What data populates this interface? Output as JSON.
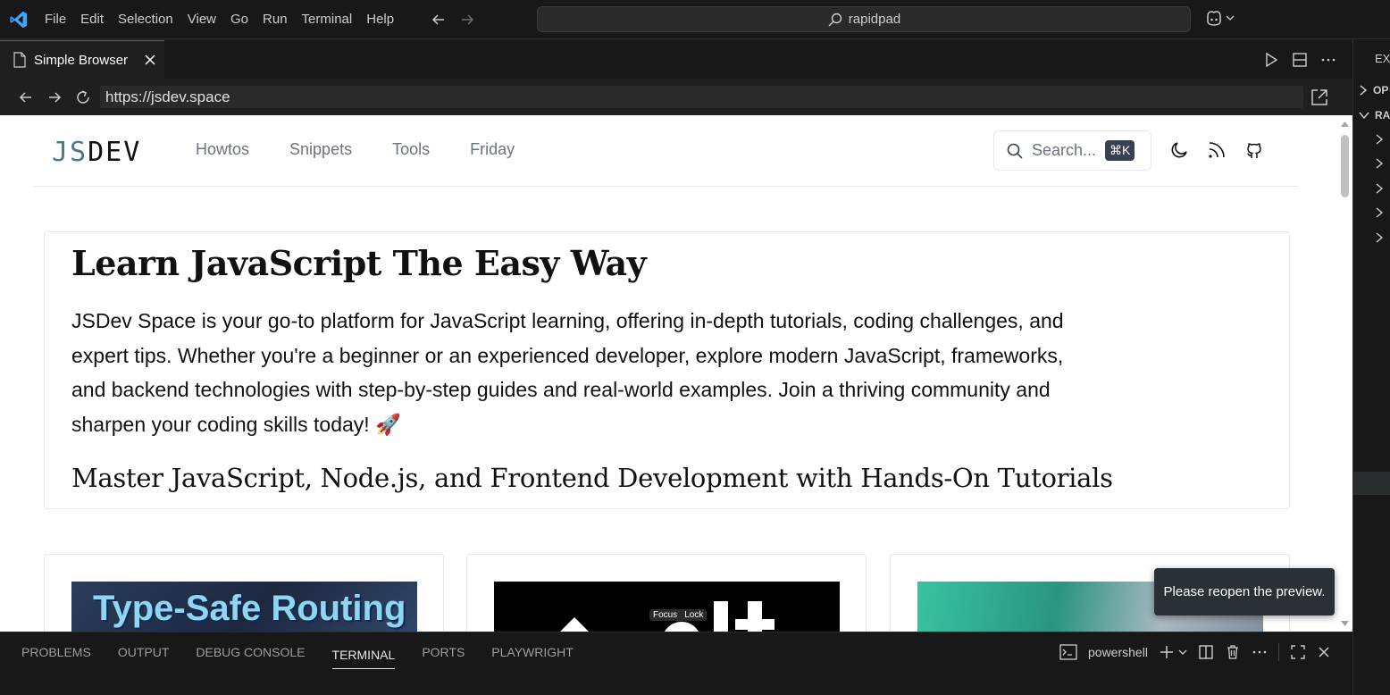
{
  "titlebar": {
    "menu": [
      "File",
      "Edit",
      "Selection",
      "View",
      "Go",
      "Run",
      "Terminal",
      "Help"
    ],
    "search_text": "rapidpad"
  },
  "editor": {
    "tab_label": "Simple Browser"
  },
  "browser": {
    "url": "https://jsdev.space"
  },
  "site": {
    "logo_left": "JS",
    "logo_right": "DEV",
    "nav": [
      "Howtos",
      "Snippets",
      "Tools",
      "Friday"
    ],
    "search_placeholder": "Search...",
    "search_shortcut": "⌘K"
  },
  "hero": {
    "title": "Learn JavaScript The Easy Way",
    "description": "JSDev Space is your go-to platform for JavaScript learning, offering in-depth tutorials, coding challenges, and expert tips. Whether you're a beginner or an experienced developer, explore modern JavaScript, frameworks, and backend technologies with step-by-step guides and real-world examples. Join a thriving community and sharpen your coding skills today! 🚀",
    "subtitle": "Master JavaScript, Node.js, and Frontend Development with Hands-On Tutorials"
  },
  "cards": {
    "card1_image_text": "Type-Safe Routing",
    "card2_focus": "Focus",
    "card2_lock": "Lock"
  },
  "tooltip": "Please reopen the preview.",
  "sidepanel": {
    "title": "EX",
    "section1": "OP",
    "section2": "RA"
  },
  "panel": {
    "tabs": [
      "PROBLEMS",
      "OUTPUT",
      "DEBUG CONSOLE",
      "TERMINAL",
      "PORTS",
      "PLAYWRIGHT"
    ],
    "active_tab": "TERMINAL",
    "shell": "powershell"
  },
  "colors": {
    "accent": "#0078d4",
    "logo_js": "#4d7a8c",
    "kbd_bg": "#374151"
  }
}
